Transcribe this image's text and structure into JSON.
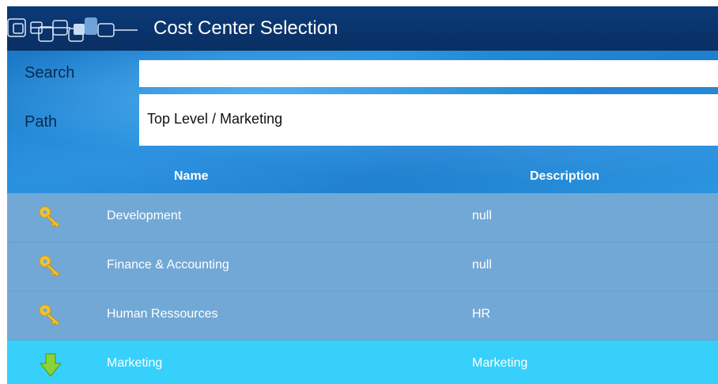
{
  "header": {
    "title": "Cost Center Selection",
    "logo_icon": "app-logo-icon"
  },
  "search": {
    "label": "Search",
    "value": ""
  },
  "path": {
    "label": "Path",
    "value": "Top Level / Marketing"
  },
  "table": {
    "columns": [
      "Name",
      "Description"
    ],
    "rows": [
      {
        "name": "Development",
        "description": "null",
        "icon": "key-icon"
      },
      {
        "name": "Finance & Accounting",
        "description": "null",
        "icon": "key-icon"
      },
      {
        "name": "Human Ressources",
        "description": "HR",
        "icon": "key-icon"
      },
      {
        "name": "Marketing",
        "description": "Marketing",
        "icon": "arrow-down-icon",
        "selected": true
      }
    ]
  },
  "colors": {
    "titlebar": "#0a2f63",
    "row": "#72a8d6",
    "row_selected": "#37d0fa",
    "key": "#f1c232",
    "arrow": "#8bd33a"
  }
}
